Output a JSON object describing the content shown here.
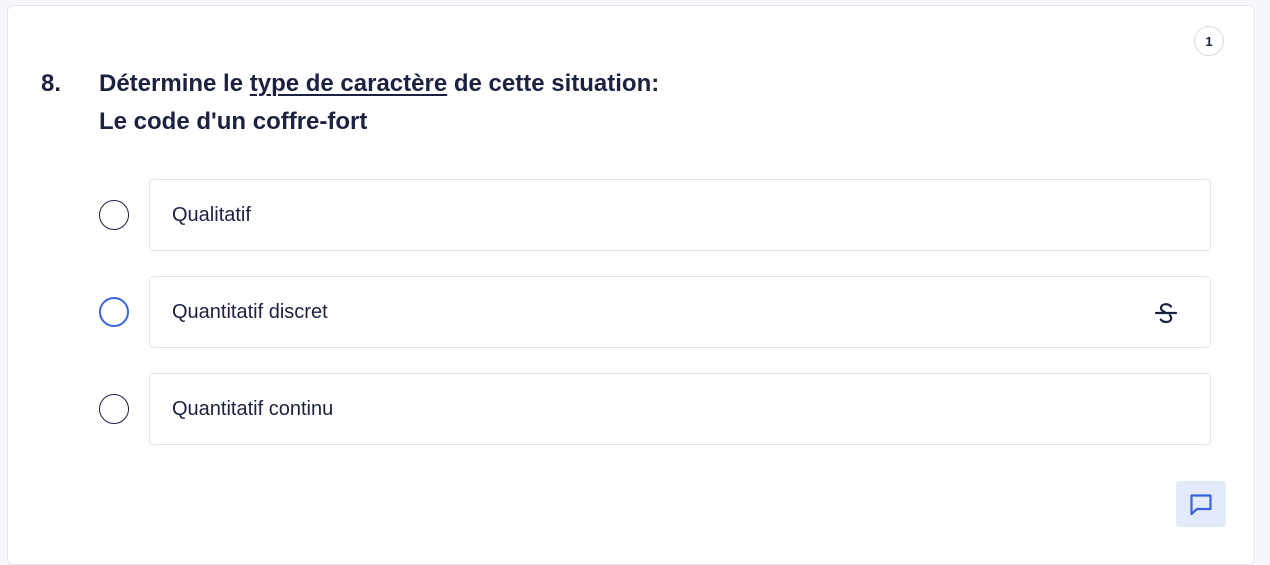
{
  "question": {
    "points": "1",
    "number": "8.",
    "prefix": "Détermine le ",
    "emphasis": "type de caractère",
    "suffix": " de cette situation:",
    "situation": "Le code d'un coffre-fort"
  },
  "options": [
    {
      "label": "Qualitatif"
    },
    {
      "label": "Quantitatif discret"
    },
    {
      "label": "Quantitatif continu"
    }
  ],
  "icons": {
    "strike": "strikethrough-icon",
    "feedback": "comment-icon"
  },
  "colors": {
    "text": "#1b2140",
    "accent": "#3b63dd",
    "feedback_bg": "#e3ebfb"
  }
}
